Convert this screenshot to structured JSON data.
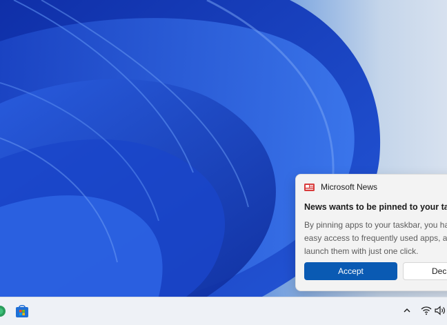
{
  "toast": {
    "app_name": "Microsoft News",
    "title": "News wants to be pinned to your taskb",
    "body_lines": [
      "By pinning apps to your taskbar, you hav",
      "easy access to frequently used apps, allo",
      "launch them with just one click."
    ],
    "accept_label": "Accept",
    "decline_label": "Dec",
    "app_icon": "news-icon",
    "accent_color": "#0a5ab3"
  },
  "taskbar": {
    "icons": [
      "edge-icon",
      "store-icon",
      "chevron-up-icon",
      "wifi-icon",
      "volume-icon"
    ]
  }
}
